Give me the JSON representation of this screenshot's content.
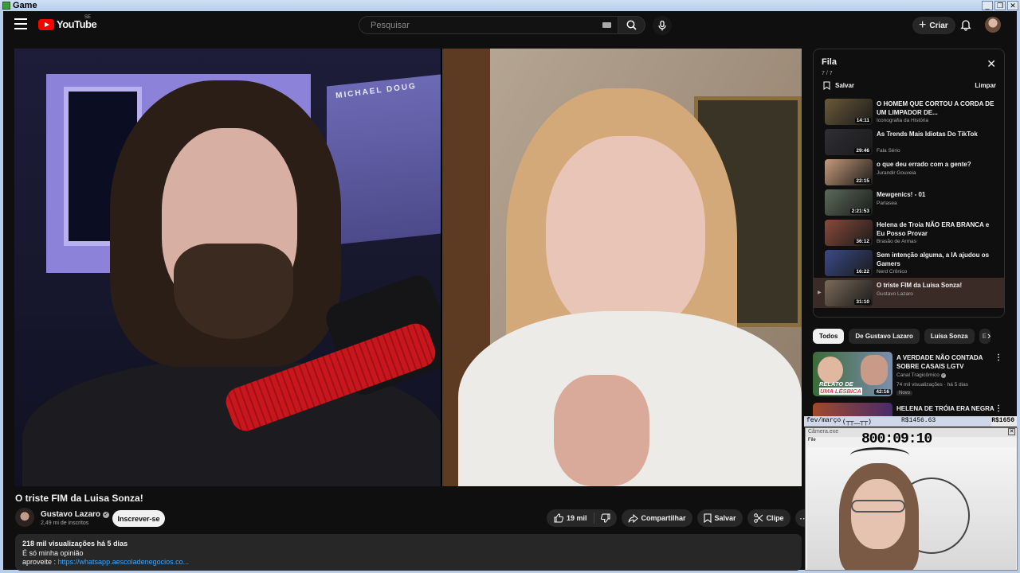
{
  "window": {
    "title": "Game"
  },
  "masthead": {
    "logo_text": "YouTube",
    "country_code": "SE",
    "search_placeholder": "Pesquisar",
    "create_label": "Criar"
  },
  "video": {
    "title": "O triste FIM da Luisa Sonza!",
    "poster_text": "MICHAEL DOUG"
  },
  "owner": {
    "name": "Gustavo Lazaro",
    "subscribers": "2,49 mi de inscritos",
    "subscribe_label": "Inscrever-se"
  },
  "actions": {
    "likes": "19 mil",
    "share": "Compartilhar",
    "save": "Salvar",
    "clip": "Clipe",
    "more": "⋯"
  },
  "description": {
    "meta": "218 mil visualizações  há 5 dias",
    "line1": "É só minha opinião",
    "line2_prefix": "aproveite : ",
    "line2_link": "https://whatsapp.aescoladenegocios.co..."
  },
  "queue": {
    "title": "Fila",
    "count": "7 / 7",
    "save_label": "Salvar",
    "clear_label": "Limpar",
    "items": [
      {
        "title": "O HOMEM QUE CORTOU A CORDA DE UM LIMPADOR DE...",
        "channel": "Iconografia da História",
        "duration": "14:11",
        "thumb_color": "#6b5a3a"
      },
      {
        "title": "As Trends Mais Idiotas Do TikTok",
        "channel": "Fala Sério",
        "duration": "29:46",
        "thumb_color": "#2f2f35"
      },
      {
        "title": "o que deu errado com a gente?",
        "channel": "Jurandir Gouveia",
        "duration": "22:15",
        "thumb_color": "#c79a7a"
      },
      {
        "title": "Mewgenics! - 01",
        "channel": "Parlasea",
        "duration": "2:21:53",
        "thumb_color": "#5a6b5a"
      },
      {
        "title": "Helena de Troia NÃO ERA BRANCA e Eu Posso Provar",
        "channel": "Brasão de Armas",
        "duration": "36:12",
        "thumb_color": "#8a4a3a"
      },
      {
        "title": "Sem intenção alguma, a IA ajudou os Gamers",
        "channel": "Nerd Crônico",
        "duration": "16:22",
        "thumb_color": "#3a4a8a"
      },
      {
        "title": "O triste FIM da Luisa Sonza!",
        "channel": "Gustavo Lazaro",
        "duration": "31:10",
        "thumb_color": "#7a6a5a",
        "current": true,
        "indicator": "▶"
      }
    ]
  },
  "chips": [
    "Todos",
    "De Gustavo Lazaro",
    "Luísa Sonza",
    "E"
  ],
  "recommendations": [
    {
      "title": "A VERDADE NÃO CONTADA SOBRE CASAIS LGTV",
      "channel": "Canal Tragicômico",
      "stats": "74 mil visualizações · há 5 dias",
      "badge": "Novo",
      "duration": "42:16",
      "thumb_text_1": "RELATO DE",
      "thumb_text_2": "UMA LÉSBICA"
    },
    {
      "title": "HELENA DE TRÓIA ERA NEGRA",
      "channel": "",
      "stats": "",
      "badge": "",
      "duration": ""
    }
  ],
  "overlay": {
    "goal_label": "fev/março",
    "goal_face": "(┬┬﹏┬┬)",
    "goal_current": "R$1456.63",
    "goal_target": "R$1650",
    "goal_progress": 0.88,
    "cam_title": "Câmera.exe",
    "cam_menu": "File",
    "cam_clock": "800:09:10"
  },
  "colors": {
    "background": "#0f0f0f",
    "accent_red": "#ff0000",
    "link_blue": "#3ea6ff",
    "current_item_bg": "#3b2b27"
  }
}
